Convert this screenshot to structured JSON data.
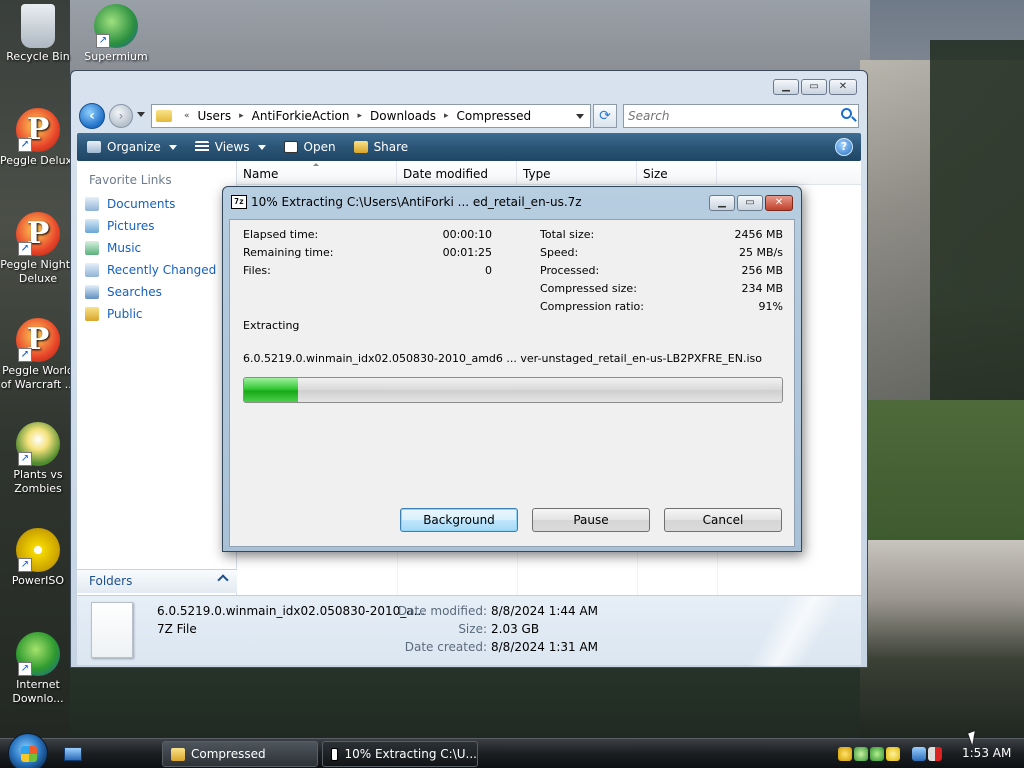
{
  "desktop": {
    "icons": [
      {
        "label": "Recycle Bin",
        "icon": "recycle-bin-icon"
      },
      {
        "label": "Supermium",
        "icon": "supermium-icon"
      },
      {
        "label": "Peggle Deluxe",
        "icon": "peggle-icon"
      },
      {
        "label": "Peggle Nights Deluxe",
        "icon": "peggle-nights-icon"
      },
      {
        "label": "Peggle World of Warcraft ...",
        "icon": "peggle-wow-icon"
      },
      {
        "label": "Plants vs Zombies",
        "icon": "plants-vs-zombies-icon"
      },
      {
        "label": "PowerISO",
        "icon": "poweriso-icon"
      },
      {
        "label": "Internet Downlo...",
        "icon": "internet-download-manager-icon"
      }
    ]
  },
  "explorer": {
    "breadcrumb": {
      "overflow": "«",
      "items": [
        "Users",
        "AntiForkieAction",
        "Downloads",
        "Compressed"
      ],
      "separator": "▸"
    },
    "search_placeholder": "Search",
    "toolbar": {
      "organize": "Organize",
      "views": "Views",
      "open": "Open",
      "share": "Share",
      "help": "?"
    },
    "favorite_links": {
      "title": "Favorite Links",
      "items": [
        "Documents",
        "Pictures",
        "Music",
        "Recently Changed",
        "Searches",
        "Public"
      ]
    },
    "folders_label": "Folders",
    "columns": [
      "Name",
      "Date modified",
      "Type",
      "Size"
    ],
    "details": {
      "name": "6.0.5219.0.winmain_idx02.050830-2010_a...",
      "type": "7Z File",
      "date_modified_label": "Date modified:",
      "date_modified": "8/8/2024 1:44 AM",
      "size_label": "Size:",
      "size": "2.03 GB",
      "date_created_label": "Date created:",
      "date_created": "8/8/2024 1:31 AM"
    },
    "window_buttons": {
      "minimize": "▁",
      "maximize": "▭",
      "close": "✕"
    }
  },
  "zip_dialog": {
    "title": "10% Extracting C:\\Users\\AntiForki ... ed_retail_en-us.7z",
    "app_badge": "7z",
    "elapsed_label": "Elapsed time:",
    "elapsed": "00:00:10",
    "remaining_label": "Remaining time:",
    "remaining": "00:01:25",
    "files_label": "Files:",
    "files": "0",
    "total_size_label": "Total size:",
    "total_size": "2456 MB",
    "speed_label": "Speed:",
    "speed": "25 MB/s",
    "processed_label": "Processed:",
    "processed": "256 MB",
    "compressed_size_label": "Compressed size:",
    "compressed_size": "234 MB",
    "compression_ratio_label": "Compression ratio:",
    "compression_ratio": "91%",
    "status": "Extracting",
    "current_file": "6.0.5219.0.winmain_idx02.050830-2010_amd6 ... ver-unstaged_retail_en-us-LB2PXFRE_EN.iso",
    "progress_fraction": 0.1,
    "buttons": {
      "background": "Background",
      "pause": "Pause",
      "cancel": "Cancel"
    }
  },
  "taskbar": {
    "tasks": [
      "Compressed",
      "10% Extracting C:\\U..."
    ],
    "clock": "1:53 AM"
  },
  "colors": {
    "link": "#1560bd",
    "progress": "#18a918",
    "toolbar": "#2b5577"
  }
}
